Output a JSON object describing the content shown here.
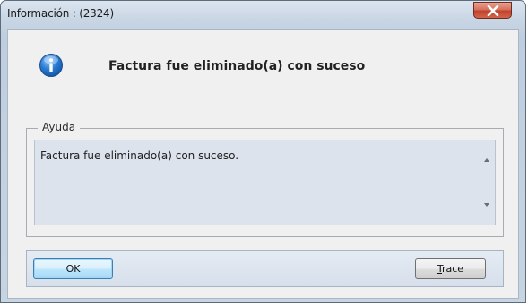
{
  "window": {
    "title": "Información : (2324)",
    "close_icon": "close-x-icon",
    "close_button_color": "#c9513a"
  },
  "message": {
    "icon": "info-icon",
    "icon_color": "#2b7cd3",
    "headline": "Factura fue eliminado(a) con suceso"
  },
  "help": {
    "legend": "Ayuda",
    "text": "Factura fue eliminado(a) con suceso.",
    "scroll_up_icon": "scroll-up-arrow-icon",
    "scroll_down_icon": "scroll-down-arrow-icon"
  },
  "buttons": {
    "ok_label": "OK",
    "trace_mnemonic": "T",
    "trace_rest": "race"
  }
}
